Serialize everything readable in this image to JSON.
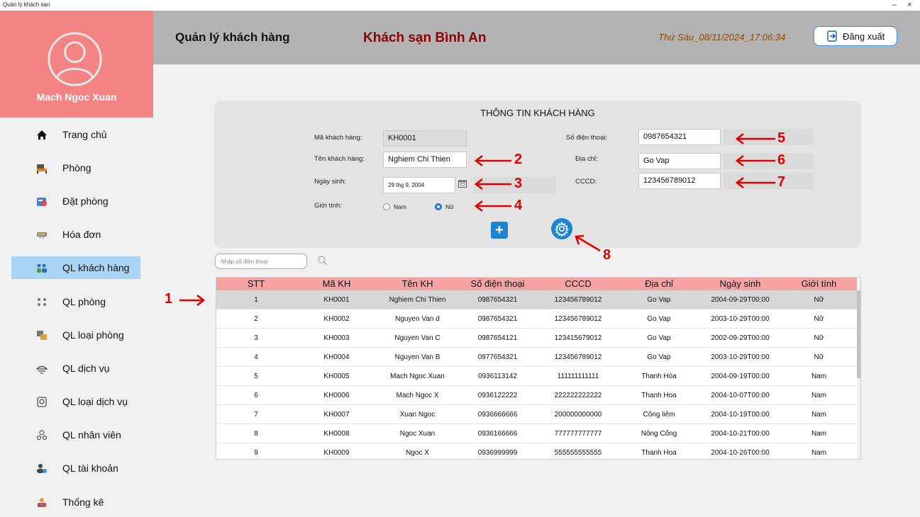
{
  "window": {
    "title": "Quản lý khách sạn",
    "minimize": "–",
    "close": "×"
  },
  "sidebar": {
    "username": "Mach Ngoc Xuan",
    "items": [
      {
        "label": "Trang chủ",
        "icon": "home-icon"
      },
      {
        "label": "Phòng",
        "icon": "room-icon"
      },
      {
        "label": "Đặt phòng",
        "icon": "booking-icon"
      },
      {
        "label": "Hóa đơn",
        "icon": "invoice-icon"
      },
      {
        "label": "QL khách hàng",
        "icon": "customers-icon"
      },
      {
        "label": "QL phòng",
        "icon": "room-manage-icon"
      },
      {
        "label": "QL loại phòng",
        "icon": "room-type-icon"
      },
      {
        "label": "QL dịch vụ",
        "icon": "service-icon"
      },
      {
        "label": "QL loại dịch vụ",
        "icon": "service-type-icon"
      },
      {
        "label": "QL nhân viên",
        "icon": "staff-icon"
      },
      {
        "label": "QL tài khoản",
        "icon": "account-icon"
      },
      {
        "label": "Thống kê",
        "icon": "stats-icon"
      }
    ],
    "active_index": 4
  },
  "header": {
    "title": "Quản lý khách hàng",
    "hotel": "Khách sạn Bình An",
    "datetime": "Thứ Sáu_08/11/2024_17:06:34",
    "logout_label": "Đăng xuất"
  },
  "form": {
    "title": "THÔNG TIN KHÁCH HÀNG",
    "id_label": "Mã khách hàng:",
    "id_value": "KH0001",
    "name_label": "Tên khách hàng:",
    "name_value": "Nghiem Chi Thien",
    "dob_label": "Ngày sinh:",
    "dob_value": "29 thg 9, 2004",
    "gender_label": "Giới tính:",
    "gender_male": "Nam",
    "gender_female": "Nữ",
    "gender_selected": "Nữ",
    "phone_label": "Số điện thoại:",
    "phone_value": "0987654321",
    "address_label": "Địa chỉ:",
    "address_value": "Go Vap",
    "cccd_label": "CCCD:",
    "cccd_value": "123456789012"
  },
  "annotations": [
    "1",
    "2",
    "3",
    "4",
    "5",
    "6",
    "7",
    "8"
  ],
  "search": {
    "placeholder": "Nhập số điện thoại"
  },
  "table": {
    "headers": [
      "STT",
      "Mã KH",
      "Tên KH",
      "Số điện thoại",
      "CCCD",
      "Địa chỉ",
      "Ngày sinh",
      "Giới tính"
    ],
    "rows": [
      [
        "1",
        "KH0001",
        "Nghiem Chi Thien",
        "0987654321",
        "123456789012",
        "Go Vap",
        "2004-09-29T00:00",
        "Nữ"
      ],
      [
        "2",
        "KH0002",
        "Nguyen Van d",
        "0987654321",
        "123456789012",
        "Go Vap",
        "2003-10-29T00:00",
        "Nữ"
      ],
      [
        "3",
        "KH0003",
        "Nguyen Van C",
        "0987654121",
        "123415679012",
        "Go Vap",
        "2002-09-29T00:00",
        "Nữ"
      ],
      [
        "4",
        "KH0004",
        "Nguyen Van B",
        "0977654321",
        "123456789012",
        "Go Vap",
        "2003-10-29T00:00",
        "Nữ"
      ],
      [
        "5",
        "KH0005",
        "Mach Ngoc Xuan",
        "0936113142",
        "111111111111",
        "Thanh Hóa",
        "2004-09-19T00:00",
        "Nam"
      ],
      [
        "6",
        "KH0006",
        "Mach Ngoc X",
        "0936122222",
        "222222222222",
        "Thanh Hoa",
        "2004-10-07T00:00",
        "Nam"
      ],
      [
        "7",
        "KH0007",
        "Xuan Ngoc",
        "0936666666",
        "200000000000",
        "Công liêm",
        "2004-10-19T00:00",
        "Nam"
      ],
      [
        "8",
        "KH0008",
        "Ngoc Xuan",
        "0936166666",
        "777777777777",
        "Nông Cống",
        "2004-10-21T00:00",
        "Nam"
      ],
      [
        "9",
        "KH0009",
        "Ngoc X",
        "0936999999",
        "555555555555",
        "Thanh Hoa",
        "2004-10-26T00:00",
        "Nam"
      ]
    ],
    "selected_row": 0
  },
  "colors": {
    "profile_bg": "#f48484",
    "header_bg": "#b3b3b3",
    "hotel_name": "#8b0000",
    "active_nav": "#a9d4f5",
    "table_header": "#f7a3a3",
    "accent": "#1b85d1",
    "annotation": "#e00000"
  }
}
